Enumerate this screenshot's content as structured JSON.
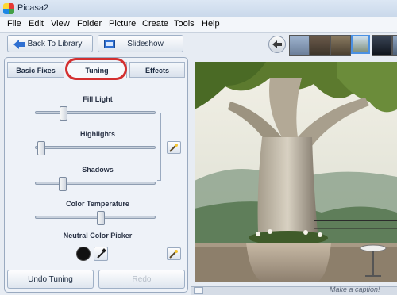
{
  "window": {
    "title": "Picasa2"
  },
  "menu": [
    "File",
    "Edit",
    "View",
    "Folder",
    "Picture",
    "Create",
    "Tools",
    "Help"
  ],
  "toolbar": {
    "back": "Back To Library",
    "slideshow": "Slideshow"
  },
  "tabs": {
    "basic": "Basic Fixes",
    "tuning": "Tuning",
    "effects": "Effects"
  },
  "sliders": {
    "fill_light": {
      "label": "Fill Light",
      "value": 0.22
    },
    "highlights": {
      "label": "Highlights",
      "value": 0.02
    },
    "shadows": {
      "label": "Shadows",
      "value": 0.21
    },
    "color_temp": {
      "label": "Color Temperature",
      "value": 0.55
    }
  },
  "color_picker": {
    "label": "Neutral Color Picker"
  },
  "footer": {
    "undo": "Undo Tuning",
    "redo": "Redo"
  },
  "caption": {
    "placeholder": "Make a caption!"
  },
  "colors": {
    "highlight_ring": "#d32f2f",
    "accent": "#2f6fd1"
  }
}
